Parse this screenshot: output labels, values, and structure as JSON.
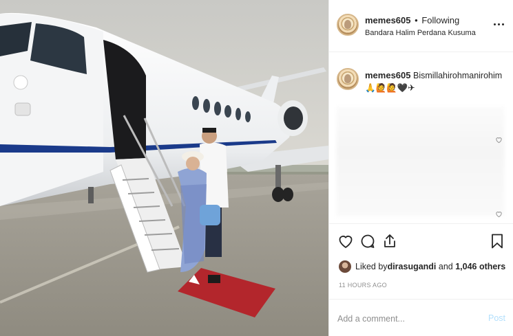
{
  "post": {
    "username": "memes605",
    "separator": "•",
    "follow_status": "Following",
    "location": "Bandara Halim Perdana Kusuma",
    "more_icon": "more-horizontal-icon"
  },
  "caption": {
    "username": "memes605",
    "text": "Bismillahirohmanirohim",
    "emojis": "🙏🙋🙋🖤✈"
  },
  "actions": {
    "icons": [
      "heart-icon",
      "comment-icon",
      "share-icon",
      "bookmark-icon"
    ]
  },
  "likes": {
    "prefix": "Liked by ",
    "user": "dirasugandi",
    "middle": " and ",
    "count_text": "1,046 others"
  },
  "timestamp": "11 HOURS AGO",
  "comment_box": {
    "placeholder": "Add a comment...",
    "post_label": "Post"
  },
  "colors": {
    "post_button": "#b2dffc",
    "muted_text": "#8e8e8e",
    "divider": "#efefef",
    "aircraft_stripe": "#1a3a8a",
    "carpet": "#b3262c"
  }
}
